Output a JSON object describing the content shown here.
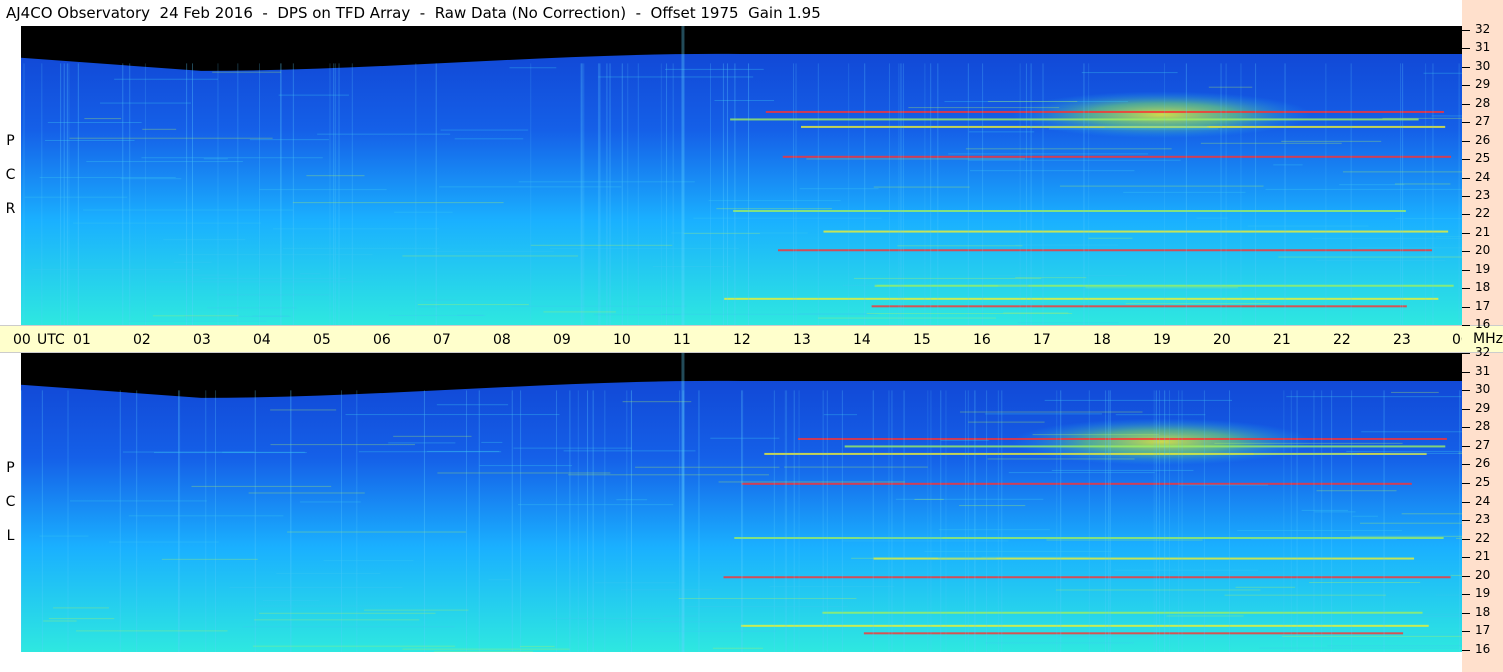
{
  "title": "AJ4CO Observatory  24 Feb 2016  -  DPS on TFD Array  -  Raw Data (No Correction)  -  Offset 1975  Gain 1.95",
  "panels": {
    "top": {
      "letters": [
        "P",
        "C",
        "R"
      ]
    },
    "bottom": {
      "letters": [
        "P",
        "C",
        "L"
      ]
    }
  },
  "utc_axis": {
    "labels": [
      "00",
      "UTC",
      "01",
      "02",
      "03",
      "04",
      "05",
      "06",
      "07",
      "08",
      "09",
      "10",
      "11",
      "12",
      "13",
      "14",
      "15",
      "16",
      "17",
      "18",
      "19",
      "20",
      "21",
      "22",
      "23",
      "00",
      "MHz"
    ]
  },
  "freq_axis": {
    "labels": [
      "32",
      "31",
      "30",
      "29",
      "28",
      "27",
      "26",
      "25",
      "24",
      "23",
      "22",
      "21",
      "20",
      "19",
      "18",
      "17",
      "16"
    ]
  },
  "chart_data": [
    {
      "type": "heatmap",
      "name": "RCP",
      "x_range_utc_hours": [
        0,
        24
      ],
      "y_range_mhz": [
        16,
        32
      ],
      "colors": {
        "background": "#000000",
        "low": "#1040d0",
        "mid": "#1ab0ff",
        "high": "#2ee8e0",
        "hot": "#f0f030",
        "peak": "#ff3030"
      },
      "emission_bands_mhz": [
        17.0,
        17.4,
        18.1,
        20.0,
        21.0,
        22.1,
        25.0,
        26.6,
        27.0,
        27.4
      ],
      "intense_region": {
        "utc_start": 16.5,
        "utc_end": 21.5,
        "mhz_start": 26.0,
        "mhz_end": 28.5
      }
    },
    {
      "type": "heatmap",
      "name": "LCP",
      "x_range_utc_hours": [
        0,
        24
      ],
      "y_range_mhz": [
        16,
        32
      ],
      "colors": {
        "background": "#000000",
        "low": "#1040d0",
        "mid": "#1ab0ff",
        "high": "#2ee8e0",
        "hot": "#f0f030",
        "peak": "#ff3030"
      },
      "emission_bands_mhz": [
        17.0,
        17.4,
        18.1,
        20.0,
        21.0,
        22.1,
        25.0,
        26.6,
        27.0,
        27.4
      ],
      "intense_region": {
        "utc_start": 16.5,
        "utc_end": 21.5,
        "mhz_start": 26.0,
        "mhz_end": 28.5
      }
    }
  ]
}
